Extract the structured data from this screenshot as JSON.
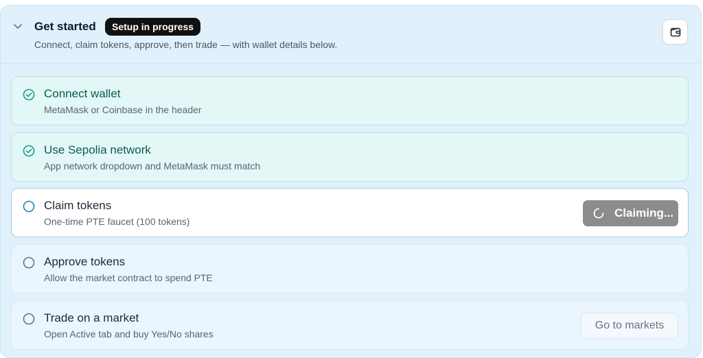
{
  "header": {
    "title": "Get started",
    "badge": "Setup in progress",
    "subtitle": "Connect, claim tokens, approve, then trade — with wallet details below.",
    "collapse_icon": "chevron-down-icon",
    "wallet_icon": "wallet-icon"
  },
  "steps": [
    {
      "title": "Connect wallet",
      "desc": "MetaMask or Coinbase in the header",
      "status": "done"
    },
    {
      "title": "Use Sepolia network",
      "desc": "App network dropdown and MetaMask must match",
      "status": "done"
    },
    {
      "title": "Claim tokens",
      "desc": "One-time PTE faucet (100 tokens)",
      "status": "active",
      "action": "Claiming..."
    },
    {
      "title": "Approve tokens",
      "desc": "Allow the market contract to spend PTE",
      "status": "pending"
    },
    {
      "title": "Trade on a market",
      "desc": "Open Active tab and buy Yes/No shares",
      "status": "pending",
      "action": "Go to markets"
    }
  ],
  "colors": {
    "done": "#1a9b86",
    "pending": "#6b7280",
    "active": "#1b83b8",
    "badge_bg": "#111111",
    "panel_bg": "#e1f1fc"
  }
}
